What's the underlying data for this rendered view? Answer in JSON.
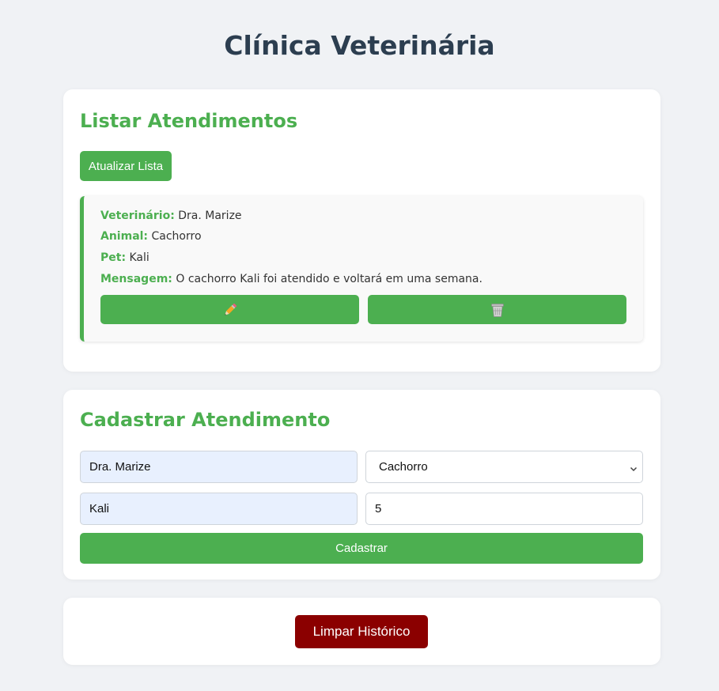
{
  "page": {
    "title": "Clínica Veterinária"
  },
  "list": {
    "heading": "Listar Atendimentos",
    "refresh_label": "Atualizar Lista",
    "records": [
      {
        "vet_label": "Veterinário:",
        "vet": "Dra. Marize",
        "animal_label": "Animal:",
        "animal": "Cachorro",
        "pet_label": "Pet:",
        "pet": "Kali",
        "message_label": "Mensagem:",
        "message": "O cachorro Kali foi atendido e voltará em uma semana.",
        "edit_icon": "pencil-icon",
        "delete_icon": "wastebasket-icon"
      }
    ]
  },
  "form": {
    "heading": "Cadastrar Atendimento",
    "vet_value": "Dra. Marize",
    "animal_selected": "Cachorro",
    "pet_value": "Kali",
    "idade_value": "5",
    "submit_label": "Cadastrar"
  },
  "footer": {
    "clear_label": "Limpar Histórico"
  },
  "colors": {
    "accent": "#4caf50",
    "title": "#2c3e50",
    "danger": "#8b0000",
    "background": "#f0f2f5",
    "autofill": "#e8f0fe"
  }
}
